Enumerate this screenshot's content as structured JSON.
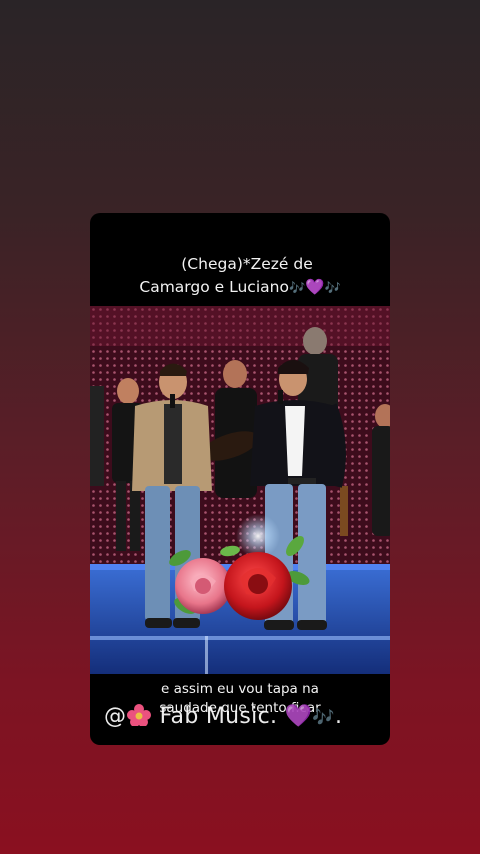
{
  "story": {
    "title_line1": "(Chega)*Zezé de",
    "title_line2": "Camargo e Luciano",
    "title_emoji_notes": "🎶",
    "title_emoji_heart": "💜",
    "caption_line1": "e assim eu vou tapa na",
    "caption_line2": "saudade que tento ficar",
    "watermark_prefix": "@",
    "watermark_name": "Fab Music.",
    "watermark_heart": "💜",
    "watermark_notes": "🎶",
    "watermark_suffix": "."
  },
  "colors": {
    "background_top": "#2a2424",
    "background_bottom": "#8a1020",
    "card": "#000000",
    "stage_floor": "#1f44a0",
    "rose_red": "#c4151c",
    "rose_pink": "#e8758a"
  },
  "icons": [
    "music-notes-icon",
    "purple-heart-icon",
    "flower-icon"
  ]
}
